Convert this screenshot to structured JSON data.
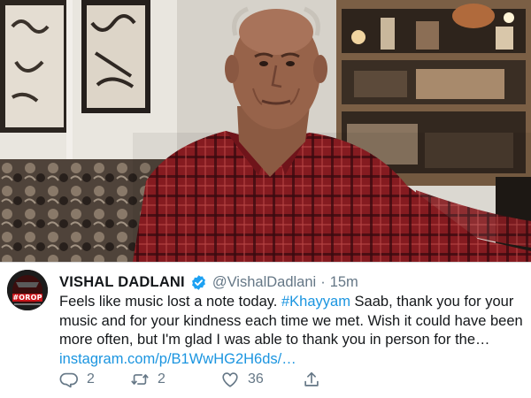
{
  "tweet": {
    "display_name": "VISHAL DADLANI",
    "handle": "@VishalDadlani",
    "separator": "·",
    "time": "15m",
    "text_1": "Feels like music lost a note today. ",
    "hashtag": "#Khayyam",
    "text_2": " Saab, thank you for your music and for your kindness each time we met. Wish it could have been more often, but I'm glad I was able to thank you in person for the…",
    "link": "instagram.com/p/B1WwHG2H6ds/…",
    "replies": "2",
    "retweets": "2",
    "likes": "36"
  },
  "avatar": {
    "text": "#OROP"
  },
  "colors": {
    "link": "#1b95e0",
    "secondary_text": "#657786",
    "verified_badge": "#1da1f2",
    "shirt": "#8e1d22"
  },
  "icons": [
    "verified-badge-icon",
    "reply-icon",
    "retweet-icon",
    "like-icon",
    "share-icon"
  ]
}
